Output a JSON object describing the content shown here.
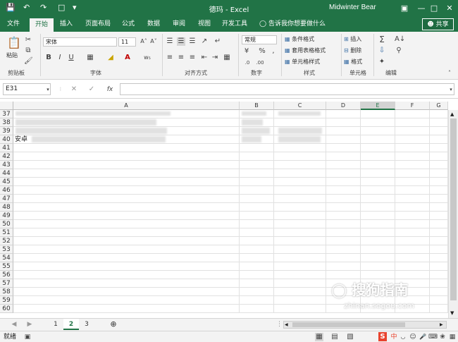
{
  "titlebar": {
    "title": "德玛 - Excel",
    "user": "Midwinter Bear",
    "save_icon": "save-icon",
    "undo_icon": "undo-icon",
    "redo_icon": "redo-icon",
    "new_icon": "new-file-icon"
  },
  "tabs": [
    "文件",
    "开始",
    "插入",
    "页面布局",
    "公式",
    "数据",
    "审阅",
    "视图",
    "开发工具"
  ],
  "tell_me": "告诉我你想要做什么",
  "share": "共享",
  "ribbon": {
    "clipboard": {
      "paste": "粘贴",
      "label": "剪贴板"
    },
    "font": {
      "name": "宋体",
      "size": "11",
      "label": "字体",
      "bold": "B",
      "italic": "I",
      "underline": "U"
    },
    "alignment": {
      "label": "对齐方式"
    },
    "number": {
      "format": "常规",
      "label": "数字",
      "percent": "%",
      "comma": ","
    },
    "styles": {
      "conditional": "条件格式",
      "table": "套用表格格式",
      "cell": "单元格样式",
      "label": "样式"
    },
    "cells": {
      "insert": "插入",
      "delete": "删除",
      "format": "格式",
      "label": "单元格"
    },
    "editing": {
      "label": "编辑"
    }
  },
  "formula_bar": {
    "name_box": "E31",
    "fx": "fx",
    "cancel": "✕",
    "enter": "✓"
  },
  "columns": [
    "A",
    "B",
    "C",
    "D",
    "E",
    "F",
    "G"
  ],
  "selected_column": "E",
  "rows": [
    "37",
    "38",
    "39",
    "40",
    "41",
    "42",
    "43",
    "44",
    "45",
    "46",
    "47",
    "48",
    "49",
    "50",
    "51",
    "52",
    "53",
    "54",
    "55",
    "56",
    "57",
    "58",
    "59",
    "60"
  ],
  "cells": {
    "a40": "安卓"
  },
  "sheets": [
    "1",
    "2",
    "3"
  ],
  "active_sheet": "2",
  "status": {
    "ready": "就绪",
    "ime": "中"
  },
  "watermark": {
    "main": "搜狗指南",
    "sub": "zhinan.sogou.com"
  }
}
